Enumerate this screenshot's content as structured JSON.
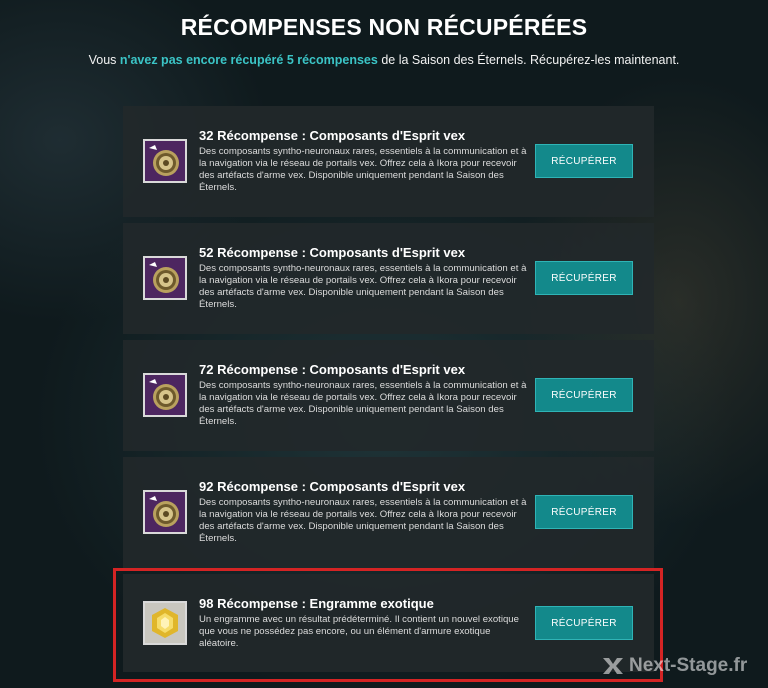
{
  "header": {
    "title": "RÉCOMPENSES NON RÉCUPÉRÉES",
    "subtitle_pre": "Vous ",
    "subtitle_highlight": "n'avez pas encore récupéré 5 récompenses",
    "subtitle_post": " de la Saison des Éternels. Récupérez-les maintenant."
  },
  "rewards": [
    {
      "title": "32 Récompense : Composants d'Esprit vex",
      "description": "Des composants syntho-neuronaux rares, essentiels à la communication et à la navigation via le réseau de portails vex. Offrez cela à Ikora pour recevoir des artéfacts d'arme vex. Disponible uniquement pendant la Saison des Éternels.",
      "button": "RÉCUPÉRER",
      "icon": "vex-mind-components-icon"
    },
    {
      "title": "52 Récompense : Composants d'Esprit vex",
      "description": "Des composants syntho-neuronaux rares, essentiels à la communication et à la navigation via le réseau de portails vex. Offrez cela à Ikora pour recevoir des artéfacts d'arme vex. Disponible uniquement pendant la Saison des Éternels.",
      "button": "RÉCUPÉRER",
      "icon": "vex-mind-components-icon"
    },
    {
      "title": "72 Récompense : Composants d'Esprit vex",
      "description": "Des composants syntho-neuronaux rares, essentiels à la communication et à la navigation via le réseau de portails vex. Offrez cela à Ikora pour recevoir des artéfacts d'arme vex. Disponible uniquement pendant la Saison des Éternels.",
      "button": "RÉCUPÉRER",
      "icon": "vex-mind-components-icon"
    },
    {
      "title": "92 Récompense : Composants d'Esprit vex",
      "description": "Des composants syntho-neuronaux rares, essentiels à la communication et à la navigation via le réseau de portails vex. Offrez cela à Ikora pour recevoir des artéfacts d'arme vex. Disponible uniquement pendant la Saison des Éternels.",
      "button": "RÉCUPÉRER",
      "icon": "vex-mind-components-icon"
    },
    {
      "title": "98 Récompense : Engramme exotique",
      "description": "Un engramme avec un résultat prédéterminé. Il contient un nouvel exotique que vous ne possédez pas encore, ou un élément d'armure exotique aléatoire.",
      "button": "RÉCUPÉRER",
      "icon": "exotic-engram-icon"
    }
  ],
  "watermark": {
    "text": "Next-Stage.fr",
    "icon": "next-stage-logo-icon"
  },
  "colors": {
    "accent": "#3bc4c6",
    "button": "#13898b",
    "highlight_border": "#d42424",
    "vex_icon_bg": "#4d2660",
    "engram_icon_bg": "#c9c7bf"
  }
}
